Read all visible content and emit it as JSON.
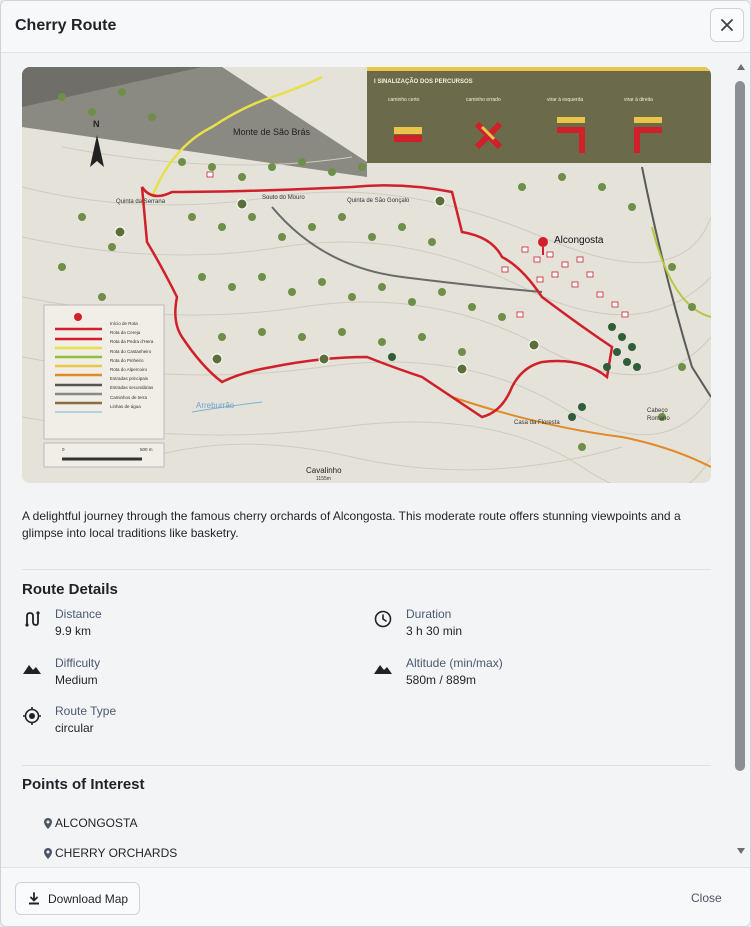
{
  "dialog": {
    "title": "Cherry Route",
    "close_icon": "close-icon"
  },
  "map": {
    "legend_panel_title": "I SINALIZAÇÃO DOS PERCURSOS",
    "signs": [
      "caminho certo",
      "caminho errado",
      "virar à esquerda",
      "virar à direita"
    ],
    "north_label": "N",
    "places": [
      "Monte de São Brás",
      "Quinta da Serrana",
      "Souto do Mouro",
      "Quinta de São Gonçalo",
      "Alcongosta",
      "Arreburrão",
      "Casa da Floresta",
      "Cabeço Romano",
      "Cavalinho"
    ],
    "altitude_label": "1155m",
    "legend_items": [
      "Início de Rota",
      "Rota da Cereja",
      "Rota da Pedra d'Hera",
      "Rota do Castanheiro",
      "Rota do Pinheiro",
      "Rota do Alpercoiro",
      "Estradas principais",
      "Estradas secundárias",
      "Caminhos de terra",
      "Linhas de água"
    ],
    "scale_labels": [
      "0",
      "500 m"
    ],
    "colors": {
      "route": "#d0202a",
      "yellow_route": "#e8e04a",
      "orange_route": "#e08a2a",
      "terrain": "#e3e1d8",
      "sign_panel": "#6b6a4a"
    }
  },
  "description": "A delightful journey through the famous cherry orchards of Alcongosta. This moderate route offers stunning viewpoints and a glimpse into local traditions like basketry.",
  "route_details": {
    "title": "Route Details",
    "distance": {
      "label": "Distance",
      "value": "9.9 km",
      "icon": "route-icon"
    },
    "duration": {
      "label": "Duration",
      "value": "3 h 30 min",
      "icon": "clock-icon"
    },
    "difficulty": {
      "label": "Difficulty",
      "value": "Medium",
      "icon": "mountain-icon"
    },
    "altitude": {
      "label": "Altitude (min/max)",
      "value": "580m / 889m",
      "icon": "mountain-icon"
    },
    "route_type": {
      "label": "Route Type",
      "value": "circular",
      "icon": "target-icon"
    }
  },
  "points_of_interest": {
    "title": "Points of Interest",
    "items": [
      "ALCONGOSTA",
      "CHERRY ORCHARDS"
    ]
  },
  "footer": {
    "download_label": "Download Map",
    "close_label": "Close"
  }
}
